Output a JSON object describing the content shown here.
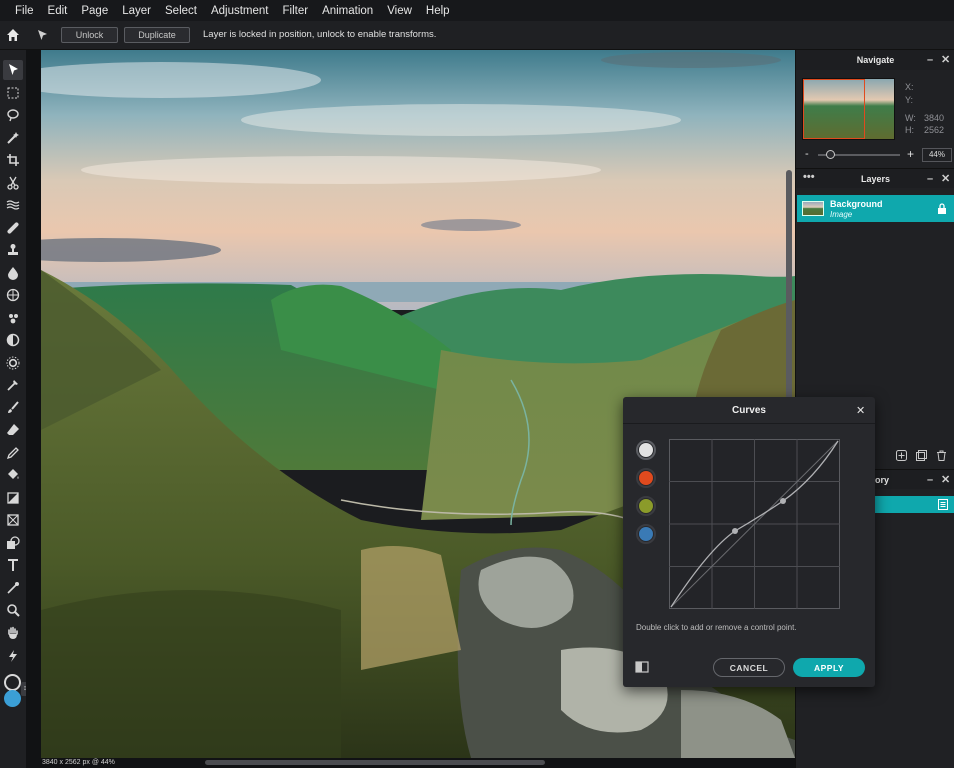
{
  "menu": [
    "File",
    "Edit",
    "Page",
    "Layer",
    "Select",
    "Adjustment",
    "Filter",
    "Animation",
    "View",
    "Help"
  ],
  "options_bar": {
    "unlock_label": "Unlock",
    "duplicate_label": "Duplicate",
    "lock_message": "Layer is locked in position, unlock to enable transforms."
  },
  "tools": [
    "pointer-icon",
    "marquee-icon",
    "lasso-icon",
    "magic-wand-icon",
    "crop-icon",
    "scissors-icon",
    "liquify-icon",
    "healing-icon",
    "stamp-icon",
    "blur-icon",
    "sponge-icon",
    "burn-icon",
    "dodge-icon",
    "brush-icon",
    "pencil-icon",
    "eraser-icon",
    "paint-bucket-icon",
    "gradient-icon",
    "transform-icon",
    "shape-icon",
    "text-icon",
    "eyedropper-icon",
    "zoom-icon",
    "hand-icon",
    "quick-fix-icon"
  ],
  "colors": {
    "accent": "#0fa8ad",
    "foreground": "#1f2023",
    "background": "#3b9fd6"
  },
  "status": "3840 x 2562 px @ 44%",
  "navigate": {
    "title": "Navigate",
    "x_label": "X:",
    "y_label": "Y:",
    "w_label": "W:",
    "h_label": "H:",
    "w_value": "3840",
    "h_value": "2562",
    "zoom_minus": "-",
    "zoom_plus": "+",
    "zoom_value": "44%",
    "zoom_fraction": 0.44
  },
  "layers": {
    "title": "Layers",
    "items": [
      {
        "name": "Background",
        "type": "Image",
        "locked": true
      }
    ]
  },
  "history": {
    "title_partial": "tory"
  },
  "curves": {
    "title": "Curves",
    "channels": [
      {
        "name": "RGB",
        "color": "#e2e2e2"
      },
      {
        "name": "Red",
        "color": "#e04a1e"
      },
      {
        "name": "Green",
        "color": "#8b9b2a"
      },
      {
        "name": "Blue",
        "color": "#3a7ab5"
      }
    ],
    "hint": "Double click to add or remove a control point.",
    "cancel_label": "CANCEL",
    "apply_label": "APPLY"
  }
}
